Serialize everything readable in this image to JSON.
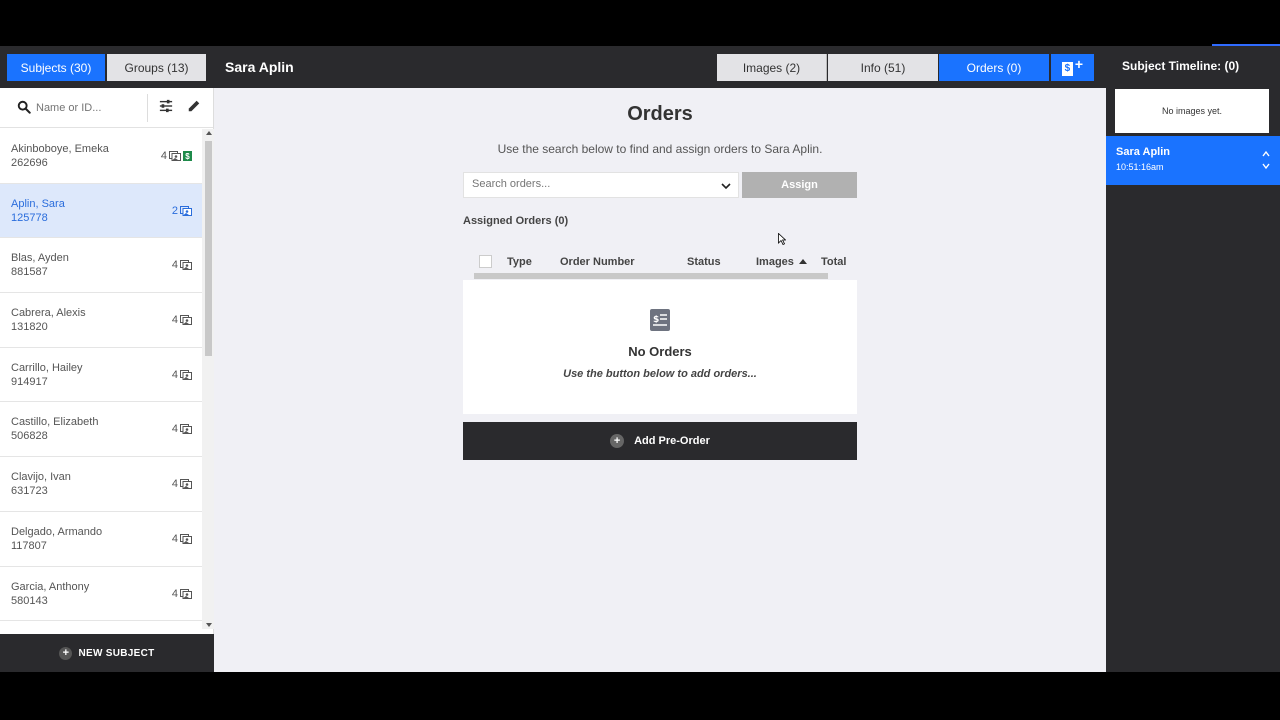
{
  "topbar": {
    "subjects_tab": "Subjects (30)",
    "groups_tab": "Groups (13)",
    "subject_title": "Sara Aplin",
    "images_tab": "Images (2)",
    "info_tab": "Info (51)",
    "orders_tab": "Orders (0)",
    "add_order_icon": "dollar-plus-icon",
    "timeline_title": "Subject Timeline: (0)"
  },
  "sidebar": {
    "search_placeholder": "Name or ID...",
    "subjects": [
      {
        "name": "Akinboboye, Emeka",
        "id": "262696",
        "count": "4",
        "badge": true,
        "selected": false
      },
      {
        "name": "Aplin, Sara",
        "id": "125778",
        "count": "2",
        "badge": false,
        "selected": true
      },
      {
        "name": "Blas, Ayden",
        "id": "881587",
        "count": "4",
        "badge": false,
        "selected": false
      },
      {
        "name": "Cabrera, Alexis",
        "id": "131820",
        "count": "4",
        "badge": false,
        "selected": false
      },
      {
        "name": "Carrillo, Hailey",
        "id": "914917",
        "count": "4",
        "badge": false,
        "selected": false
      },
      {
        "name": "Castillo, Elizabeth",
        "id": "506828",
        "count": "4",
        "badge": false,
        "selected": false
      },
      {
        "name": "Clavijo, Ivan",
        "id": "631723",
        "count": "4",
        "badge": false,
        "selected": false
      },
      {
        "name": "Delgado, Armando",
        "id": "117807",
        "count": "4",
        "badge": false,
        "selected": false
      },
      {
        "name": "Garcia, Anthony",
        "id": "580143",
        "count": "4",
        "badge": false,
        "selected": false
      }
    ],
    "new_subject_label": "NEW SUBJECT"
  },
  "main": {
    "title": "Orders",
    "subtitle": "Use the search below to find and assign orders to Sara Aplin.",
    "search_placeholder": "Search orders...",
    "assign_label": "Assign",
    "assigned_label": "Assigned Orders (0)",
    "columns": [
      "Type",
      "Order Number",
      "Status",
      "Images",
      "Total"
    ],
    "empty_title": "No Orders",
    "empty_subtitle": "Use the button below to add orders...",
    "add_preorder_label": "Add Pre-Order"
  },
  "timeline": {
    "no_images": "No images yet.",
    "entry_name": "Sara Aplin",
    "entry_time": "10:51:16am"
  },
  "colors": {
    "accent": "#1a73ff",
    "dark": "#2a2a2d",
    "panel_bg": "#f0f0f5",
    "money_badge": "#1e8a4a"
  }
}
